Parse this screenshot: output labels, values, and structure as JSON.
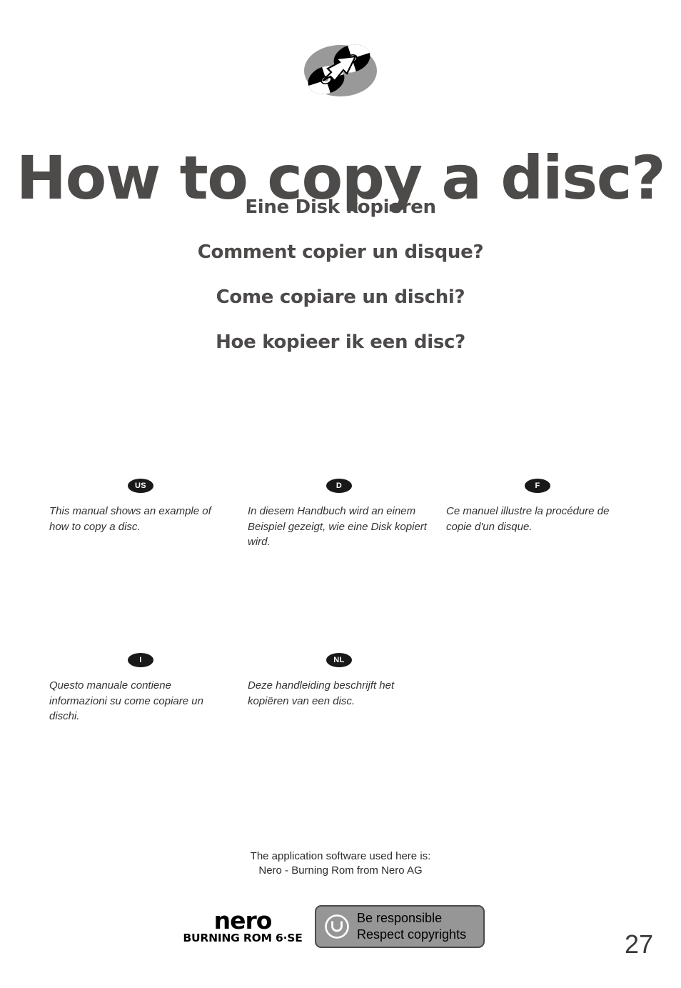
{
  "hero": {
    "icon_name": "copy-disc-icon",
    "title": "How to copy a disc?",
    "subtitles": [
      "Eine Disk kopieren",
      "Comment copier un disque?",
      "Come copiare un dischi?",
      "Hoe kopieer ik een disc?"
    ]
  },
  "languages": {
    "row1": [
      {
        "badge": "US",
        "text": "This manual shows an example of how to copy a disc."
      },
      {
        "badge": "D",
        "text": "In diesem Handbuch wird an einem Beispiel gezeigt, wie eine Disk kopiert wird."
      },
      {
        "badge": "F",
        "text": "Ce manuel illustre la procédure de copie d'un disque."
      }
    ],
    "row2": [
      {
        "badge": "I",
        "text": "Questo manuale contiene informazioni su come copiare un dischi."
      },
      {
        "badge": "NL",
        "text": "Deze handleiding beschrijft het kopiëren van een disc."
      }
    ]
  },
  "footer": {
    "app_note_line1": "The application software used here is:",
    "app_note_line2": "Nero - Burning Rom from Nero AG",
    "logo": {
      "word": "nero",
      "sub": "BURNING ROM 6·SE"
    },
    "copyright_badge": {
      "icon_name": "copyright-symbol-icon",
      "line1": "Be responsible",
      "line2": "Respect copyrights"
    },
    "page_number": "27"
  },
  "colors": {
    "title_gray": "#4d4a4a",
    "body_text": "#333333",
    "badge_black": "#191919",
    "badge_gray": "#969696",
    "badge_border": "#4a4a4a",
    "icon_ellipse_gray": "#999999",
    "page_number_gray": "#3a3a3a"
  }
}
